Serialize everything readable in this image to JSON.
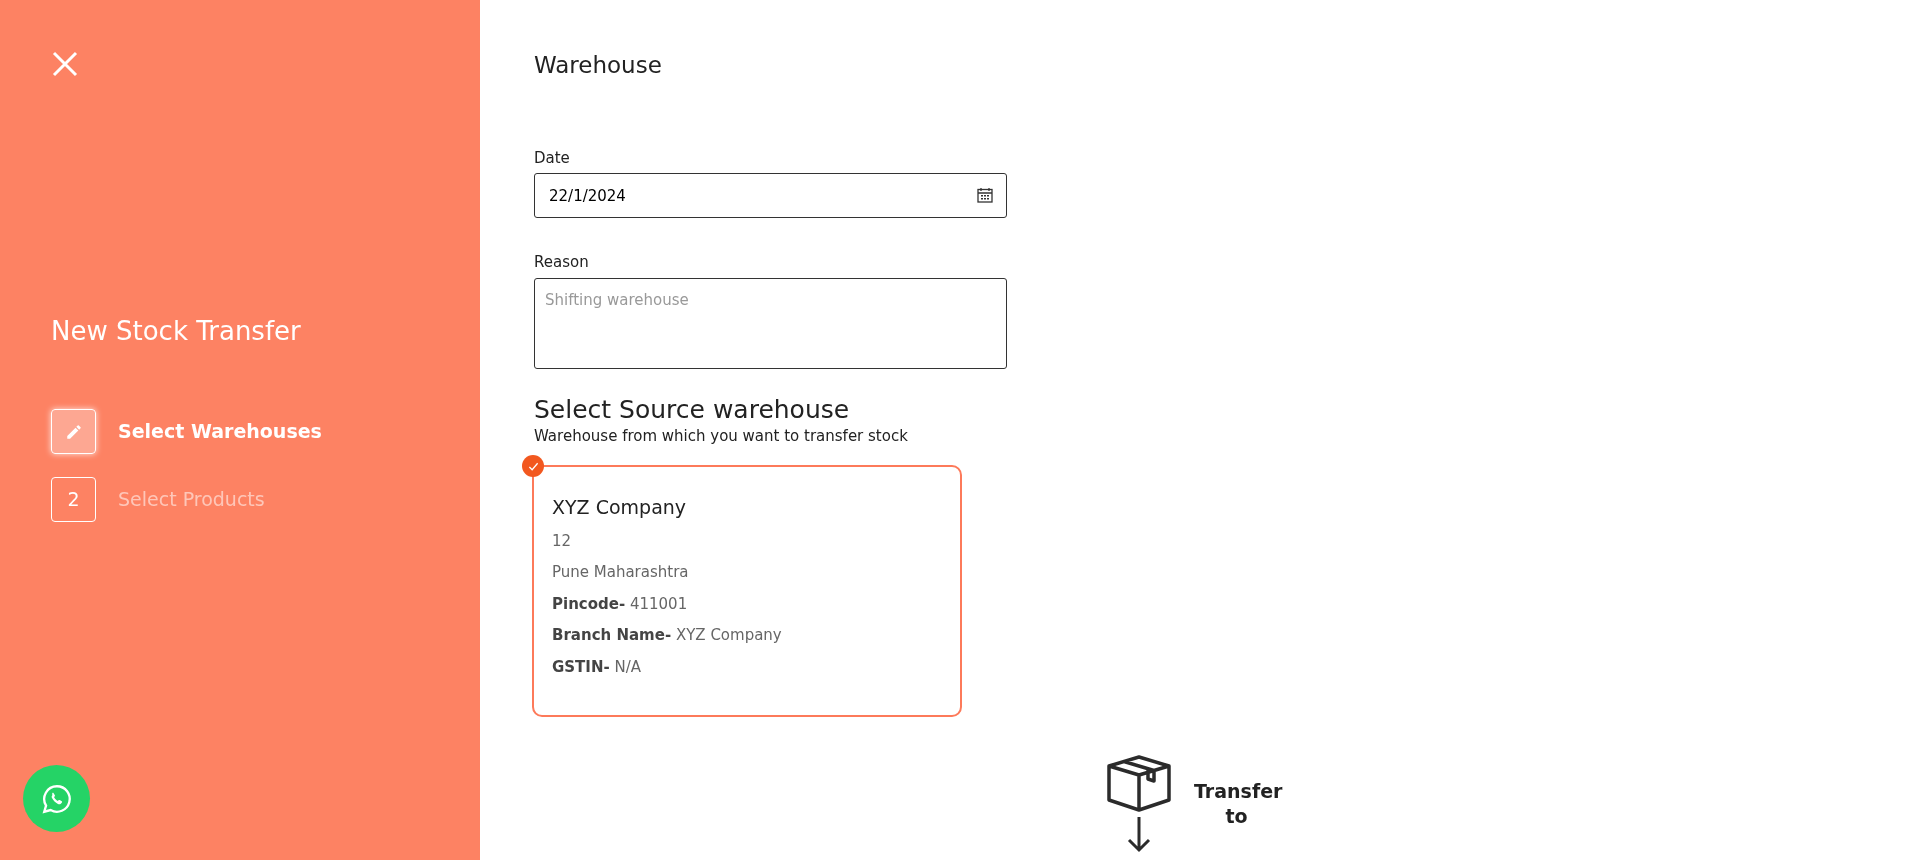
{
  "sidebar": {
    "title": "New Stock Transfer",
    "steps": [
      {
        "kind": "icon",
        "label": "Select Warehouses",
        "selected": true
      },
      {
        "kind": "number",
        "number": "2",
        "label": "Select Products",
        "selected": false
      }
    ]
  },
  "main": {
    "title": "Warehouse",
    "date": {
      "label": "Date",
      "value": "22/1/2024"
    },
    "reason": {
      "label": "Reason",
      "placeholder": "Shifting warehouse"
    },
    "source": {
      "title": "Select Source warehouse",
      "subtitle": "Warehouse from which you want to transfer stock",
      "warehouses": [
        {
          "name": "XYZ Company",
          "selected": true,
          "lines": [
            "12",
            "Pune Maharashtra",
            "**Pincode-** 411001",
            "**Branch Name-** XYZ Company",
            "**GSTIN-** N/A"
          ]
        }
      ]
    },
    "transfer": {
      "label": "Transfer to"
    }
  }
}
